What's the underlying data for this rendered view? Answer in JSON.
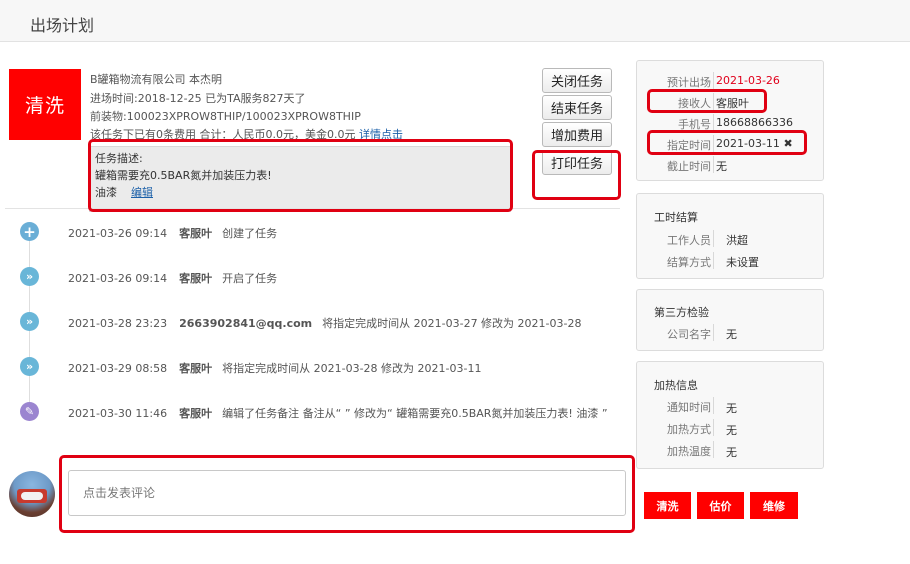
{
  "header": {
    "title": "出场计划"
  },
  "task": {
    "badge": "清洗",
    "company": "B罐箱物流有限公司 本杰明",
    "entry": "进场时间:2018-12-25 已为TA服务827天了",
    "cargo": "前装物:100023XPROW8THIP/100023XPROW8THIP",
    "fees": "该任务下已有0条费用 合计：人民币0.0元，美金0.0元",
    "fees_link": "详情点击",
    "desc_title": "任务描述:",
    "desc_text": "罐箱需要充0.5BAR氮并加装压力表!",
    "desc_extra": "油漆",
    "desc_edit": "编辑"
  },
  "actions": [
    "关闭任务",
    "结束任务",
    "增加费用",
    "打印任务"
  ],
  "timeline": [
    {
      "icon": "plus-icon",
      "time": "2021-03-26 09:14",
      "user": "客服叶",
      "text": "创建了任务"
    },
    {
      "icon": "double-chevron-icon",
      "time": "2021-03-26 09:14",
      "user": "客服叶",
      "text": "开启了任务"
    },
    {
      "icon": "double-chevron-icon",
      "time": "2021-03-28 23:23",
      "user": "2663902841@qq.com",
      "text": "将指定完成时间从 2021-03-27 修改为 2021-03-28"
    },
    {
      "icon": "double-chevron-icon",
      "time": "2021-03-29 08:58",
      "user": "客服叶",
      "text": "将指定完成时间从 2021-03-28 修改为 2021-03-11"
    },
    {
      "icon": "pencil-icon",
      "time": "2021-03-30 11:46",
      "user": "客服叶",
      "text": "编辑了任务备注 备注从“ ” 修改为“ 罐箱需要充0.5BAR氮并加装压力表!  油漆 ”"
    }
  ],
  "comment": {
    "placeholder": "点击发表评论"
  },
  "schedule": {
    "expected_label": "预计出场",
    "expected_value": "2021-03-26",
    "receiver_label": "接收人",
    "receiver_value": "客服叶",
    "phone_label": "手机号",
    "phone_value": "18668866336",
    "assigned_label": "指定时间",
    "assigned_value": "2021-03-11",
    "deadline_label": "截止时间",
    "deadline_value": "无"
  },
  "work": {
    "title": "工时结算",
    "worker_label": "工作人员",
    "worker_value": "洪超",
    "method_label": "结算方式",
    "method_value": "未设置"
  },
  "inspection": {
    "title": "第三方检验",
    "company_label": "公司名字",
    "company_value": "无"
  },
  "heating": {
    "title": "加热信息",
    "notify_label": "通知时间",
    "notify_value": "无",
    "method_label": "加热方式",
    "method_value": "无",
    "temp_label": "加热温度",
    "temp_value": "无"
  },
  "bottom_buttons": [
    "清洗",
    "估价",
    "维修"
  ],
  "colors": {
    "accent_red": "#ff0000",
    "highlight_red": "#e00012",
    "link_blue": "#1a5fa8",
    "date_red": "#e0001b"
  }
}
